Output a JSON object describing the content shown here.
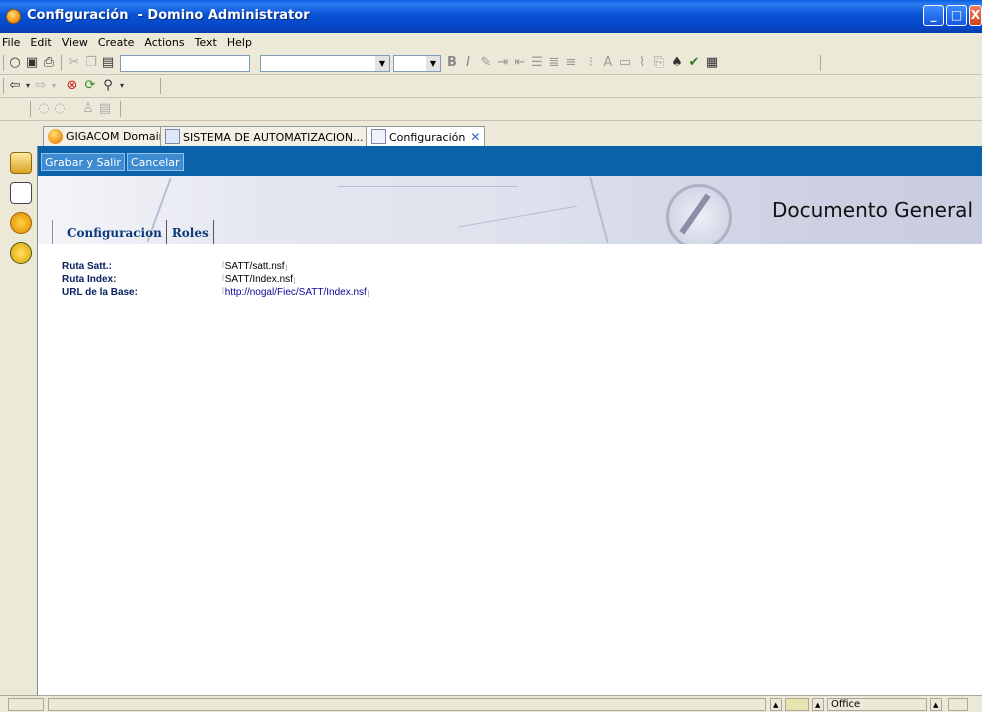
{
  "window": {
    "title": "Configuración  - Domino Administrator",
    "min_glyph": "_",
    "max_glyph": "□",
    "close_glyph": "X"
  },
  "menu": [
    "File",
    "Edit",
    "View",
    "Create",
    "Actions",
    "Text",
    "Help"
  ],
  "tabs": [
    {
      "label": "GIGACOM Domain",
      "icon": "domain-icon",
      "closable": false
    },
    {
      "label": "SISTEMA DE AUTOMATIZACION...",
      "icon": "database-icon",
      "closable": true
    },
    {
      "label": "Configuración",
      "icon": "document-icon",
      "closable": true
    }
  ],
  "tab_close_glyph": "✕",
  "actions": {
    "save_exit": "Grabar y Salir",
    "cancel": "Cancelar"
  },
  "banner": {
    "heading": "Documento General"
  },
  "form_tabs": [
    "Configuracion",
    "Roles"
  ],
  "fields": [
    {
      "label": "Ruta Satt.:",
      "value": "SATT/satt.nsf",
      "link": false
    },
    {
      "label": "Ruta Index:",
      "value": "SATT/Index.nsf",
      "link": false
    },
    {
      "label": "URL de la Base:",
      "value": "http://nogal/Fiec/SATT/Index.nsf",
      "link": true
    }
  ],
  "field_brackets": {
    "open": "⌈",
    "close": "⌋"
  },
  "status": {
    "location": "Office"
  },
  "colors": {
    "action_bar": "#0a63a8",
    "title_bar": "#0646c4",
    "field_label": "#0a2060"
  }
}
